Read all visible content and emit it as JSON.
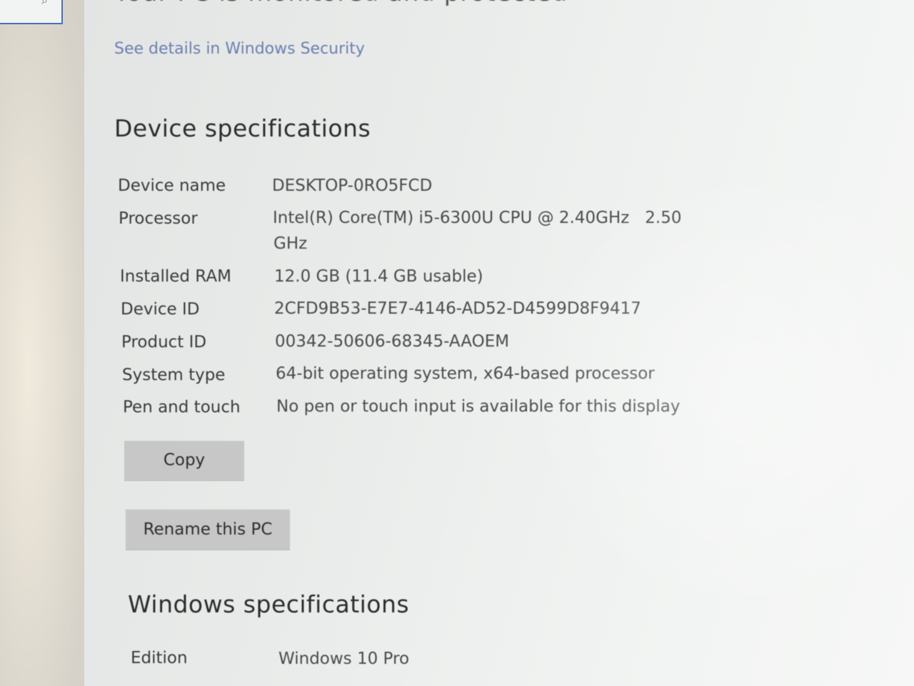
{
  "header": {
    "cut_title": "Your PC is monitored and protected",
    "security_link": "See details in Windows Security"
  },
  "device_specs": {
    "heading": "Device specifications",
    "rows": [
      {
        "label": "Device name",
        "value": "DESKTOP-0RO5FCD"
      },
      {
        "label": "Processor",
        "value": "Intel(R) Core(TM) i5-6300U CPU @ 2.40GHz   2.50",
        "value2": "GHz"
      },
      {
        "label": "Installed RAM",
        "value": "12.0 GB (11.4 GB usable)"
      },
      {
        "label": "Device ID",
        "value": "2CFD9B53-E7E7-4146-AD52-D4599D8F9417"
      },
      {
        "label": "Product ID",
        "value": "00342-50606-68345-AAOEM"
      },
      {
        "label": "System type",
        "value": "64-bit operating system, x64-based processor"
      },
      {
        "label": "Pen and touch",
        "value": "No pen or touch input is available for this display"
      }
    ],
    "copy_label": "Copy",
    "rename_label": "Rename this PC"
  },
  "windows_specs": {
    "heading": "Windows specifications",
    "rows": [
      {
        "label": "Edition",
        "value": "Windows 10 Pro"
      }
    ]
  },
  "colors": {
    "link": "#6a7fb0",
    "button": "#c6c7c6",
    "search_border": "#4a6fbf"
  }
}
